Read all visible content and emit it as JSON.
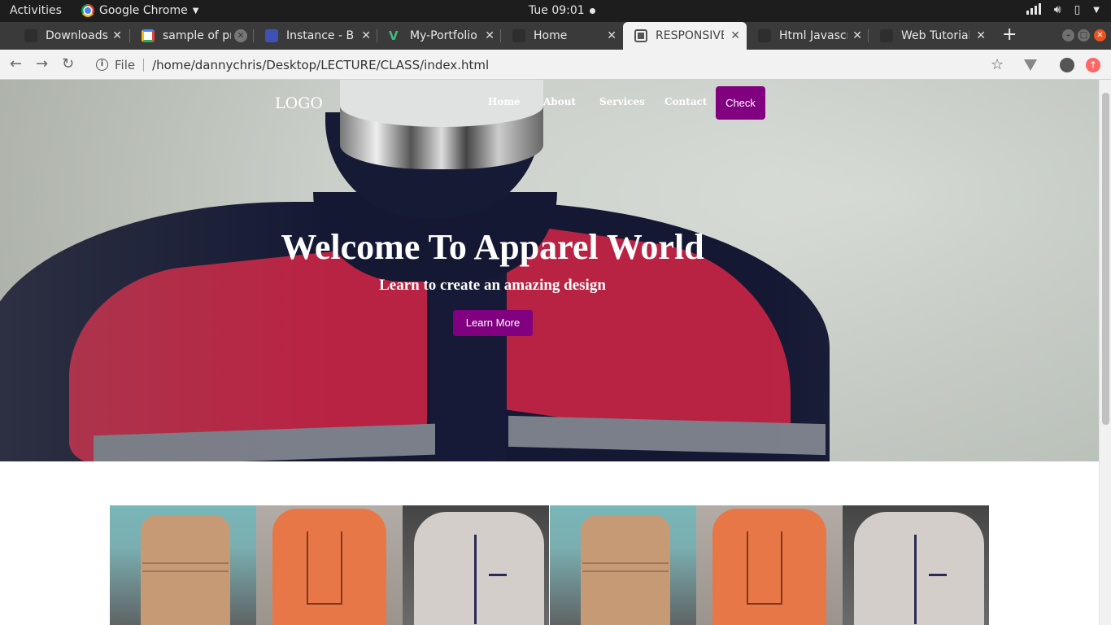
{
  "system": {
    "activities": "Activities",
    "app_name": "Google Chrome",
    "clock": "Tue 09:01"
  },
  "browser": {
    "tabs": [
      {
        "title": "Downloads",
        "favicon": "blank-icon",
        "active": false
      },
      {
        "title": "sample of pr",
        "favicon": "google-icon",
        "active": false
      },
      {
        "title": "Instance - Bo",
        "favicon": "bootstrap-icon",
        "active": false
      },
      {
        "title": "My-Portfolio",
        "favicon": "vue-icon",
        "active": false
      },
      {
        "title": "Home",
        "favicon": "blank-icon",
        "active": false
      },
      {
        "title": "RESPONSIVE",
        "favicon": "globe-icon",
        "active": true
      },
      {
        "title": "Html Javascr",
        "favicon": "blank-icon",
        "active": false
      },
      {
        "title": "Web Tutorial",
        "favicon": "blank-icon",
        "active": false
      }
    ],
    "address": {
      "scheme": "File",
      "url": "/home/dannychris/Desktop/LECTURE/CLASS/index.html"
    }
  },
  "page": {
    "nav": {
      "logo": "LOGO",
      "links": [
        "Home",
        "About",
        "Services",
        "Contact"
      ],
      "cta": "Check"
    },
    "hero": {
      "title": "Welcome To Apparel World",
      "subtitle": "Learn to create an amazing design",
      "button": "Learn More"
    }
  },
  "colors": {
    "brand_purple": "#800080",
    "topbar": "#1d1d1d",
    "tabstrip": "#3a3a3a",
    "ubuntu_close": "#e95420"
  }
}
